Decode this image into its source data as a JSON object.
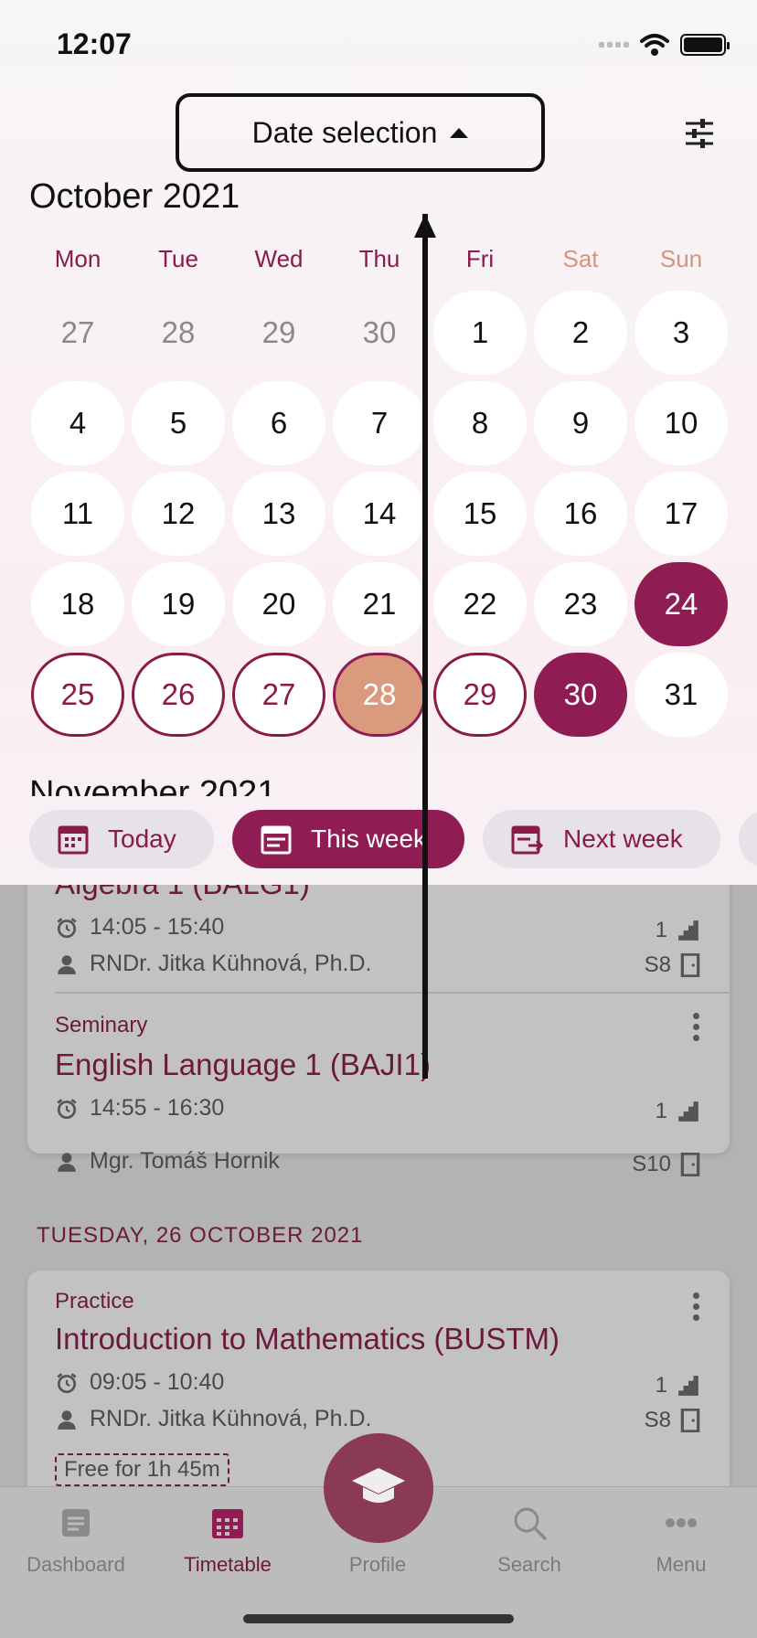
{
  "status_bar": {
    "time": "12:07"
  },
  "header": {
    "date_selection_label": "Date selection"
  },
  "calendar": {
    "month_title": "October 2021",
    "next_month_title": "November 2021",
    "weekdays": [
      "Mon",
      "Tue",
      "Wed",
      "Thu",
      "Fri",
      "Sat",
      "Sun"
    ],
    "days": [
      {
        "n": "27",
        "s": "muted"
      },
      {
        "n": "28",
        "s": "muted"
      },
      {
        "n": "29",
        "s": "muted"
      },
      {
        "n": "30",
        "s": "muted"
      },
      {
        "n": "1",
        "s": "normal"
      },
      {
        "n": "2",
        "s": "normal"
      },
      {
        "n": "3",
        "s": "normal"
      },
      {
        "n": "4",
        "s": "normal"
      },
      {
        "n": "5",
        "s": "normal"
      },
      {
        "n": "6",
        "s": "normal"
      },
      {
        "n": "7",
        "s": "normal"
      },
      {
        "n": "8",
        "s": "normal"
      },
      {
        "n": "9",
        "s": "normal"
      },
      {
        "n": "10",
        "s": "normal"
      },
      {
        "n": "11",
        "s": "normal"
      },
      {
        "n": "12",
        "s": "normal"
      },
      {
        "n": "13",
        "s": "normal"
      },
      {
        "n": "14",
        "s": "normal"
      },
      {
        "n": "15",
        "s": "normal"
      },
      {
        "n": "16",
        "s": "normal"
      },
      {
        "n": "17",
        "s": "normal"
      },
      {
        "n": "18",
        "s": "normal"
      },
      {
        "n": "19",
        "s": "normal"
      },
      {
        "n": "20",
        "s": "normal"
      },
      {
        "n": "21",
        "s": "normal"
      },
      {
        "n": "22",
        "s": "normal"
      },
      {
        "n": "23",
        "s": "normal"
      },
      {
        "n": "24",
        "s": "filled"
      },
      {
        "n": "25",
        "s": "outline"
      },
      {
        "n": "26",
        "s": "outline"
      },
      {
        "n": "27",
        "s": "outline"
      },
      {
        "n": "28",
        "s": "today"
      },
      {
        "n": "29",
        "s": "outline"
      },
      {
        "n": "30",
        "s": "filled"
      },
      {
        "n": "31",
        "s": "normal"
      }
    ]
  },
  "quick_ranges": {
    "today": "Today",
    "this_week": "This week",
    "next_week": "Next week"
  },
  "events": {
    "e1": {
      "title": "Algebra 1 (BALG1)",
      "time": "14:05 - 15:40",
      "teacher": "RNDr. Jitka Kühnová, Ph.D.",
      "floor": "1",
      "room": "S8"
    },
    "e2": {
      "type": "Seminary",
      "title": "English Language 1 (BAJI1)",
      "time": "14:55 - 16:30",
      "teacher": "Mgr. Tomáš Hornik",
      "floor": "1",
      "room": "S10"
    },
    "day2_header": "TUESDAY, 26 OCTOBER 2021",
    "e3": {
      "type": "Practice",
      "title": "Introduction to Mathematics (BUSTM)",
      "time": "09:05 - 10:40",
      "teacher": "RNDr. Jitka Kühnová, Ph.D.",
      "floor": "1",
      "room": "S8"
    },
    "free": "Free for  1h 45m"
  },
  "tabbar": {
    "dashboard": "Dashboard",
    "timetable": "Timetable",
    "profile": "Profile",
    "search": "Search",
    "menu": "Menu"
  },
  "colors": {
    "accent": "#8f1c52",
    "today": "#d99a7e",
    "weekend": "#d4957a"
  }
}
